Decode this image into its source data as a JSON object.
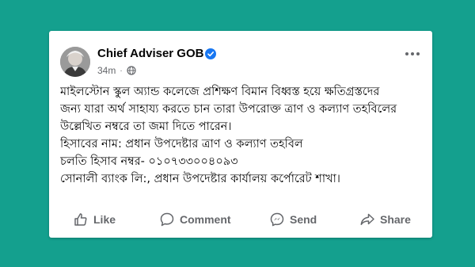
{
  "post": {
    "author": "Chief Adviser GOB",
    "time": "34m",
    "dot": "·",
    "lines": [
      "মাইলস্টোন স্কুল অ্যান্ড কলেজে প্রশিক্ষণ বিমান বিধ্বস্ত হয়ে ক্ষতিগ্রস্তদের",
      "জন্য যারা অর্থ সাহায্য করতে চান তারা উপরোক্ত ত্রাণ ও কল্যাণ তহবিলের",
      "উল্লেখিত নম্বরে তা জমা দিতে পারেন।",
      "হিসাবের নাম: প্রধান উপদেষ্টার ত্রাণ ও কল্যাণ তহবিল",
      "চলতি হিসাব নম্বর- ০১০৭৩৩০০৪০৯৩",
      "সোনালী ব্যাংক লি:, প্রধান উপদেষ্টার কার্যালয় কর্পোরেট শাখা।"
    ]
  },
  "actions": {
    "like": "Like",
    "comment": "Comment",
    "send": "Send",
    "share": "Share"
  },
  "icons": {
    "verified": "verified-badge-icon",
    "globe": "globe-icon",
    "more": "more-options-icon",
    "like": "thumbs-up-icon",
    "comment": "comment-bubble-icon",
    "send": "messenger-icon",
    "share": "share-arrow-icon"
  },
  "colors": {
    "background": "#14a08e",
    "verified": "#1877f2",
    "muted": "#65676b"
  }
}
